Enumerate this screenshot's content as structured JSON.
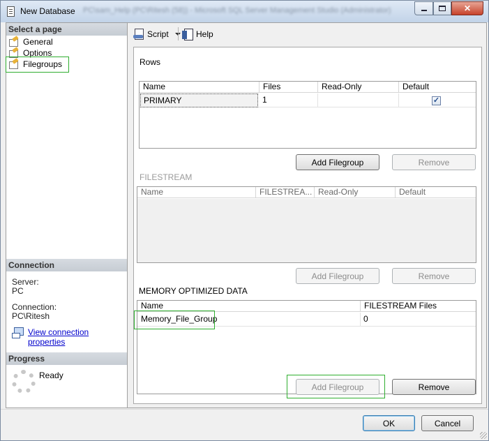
{
  "window": {
    "title": "New Database",
    "title_extra": "PC\\sam_Help (PC\\Ritesh (58)) - Microsoft SQL Server Management Studio (Administrator)",
    "min_label": "",
    "max_label": "",
    "close_label": "✕"
  },
  "sidebar": {
    "select_header": "Select a page",
    "pages": [
      {
        "label": "General",
        "icon": "page-wrench-icon"
      },
      {
        "label": "Options",
        "icon": "page-wrench-icon"
      },
      {
        "label": "Filegroups",
        "icon": "page-wrench-icon",
        "selected": true
      }
    ],
    "connection_header": "Connection",
    "server_label": "Server:",
    "server_value": "PC",
    "connection_label": "Connection:",
    "connection_value": "PC\\Ritesh",
    "view_link": "View connection properties",
    "progress_header": "Progress",
    "progress_status": "Ready"
  },
  "toolbar": {
    "script_label": "Script",
    "help_label": "Help"
  },
  "rows_section": {
    "label": "Rows",
    "columns": [
      "Name",
      "Files",
      "Read-Only",
      "Default"
    ],
    "rows": [
      {
        "name": "PRIMARY",
        "files": "1",
        "read_only": false,
        "default": true
      }
    ],
    "add_button": "Add Filegroup",
    "remove_button": "Remove"
  },
  "filestream_section": {
    "label": "FILESTREAM",
    "columns": [
      "Name",
      "FILESTREA...",
      "Read-Only",
      "Default"
    ],
    "add_button": "Add Filegroup",
    "remove_button": "Remove"
  },
  "memory_section": {
    "label": "MEMORY OPTIMIZED DATA",
    "columns": [
      "Name",
      "FILESTREAM Files"
    ],
    "rows": [
      {
        "name": "Memory_File_Group",
        "files": "0"
      }
    ],
    "add_button": "Add Filegroup",
    "remove_button": "Remove"
  },
  "footer": {
    "ok_button": "OK",
    "cancel_button": "Cancel"
  },
  "colors": {
    "highlight_box": "#2fae2f",
    "link": "#0000cc",
    "close_button": "#c7432b"
  }
}
